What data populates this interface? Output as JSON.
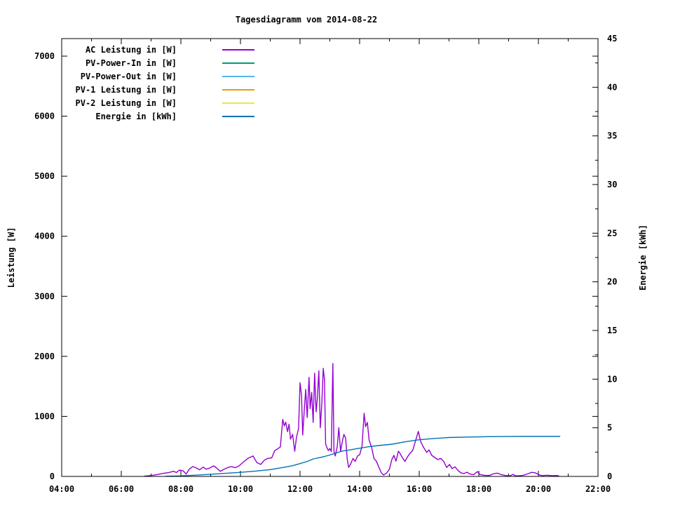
{
  "chart_data": {
    "type": "line",
    "title": "Tagesdiagramm vom 2014-08-22",
    "x_axis": {
      "min": 4,
      "max": 22,
      "major_ticks": [
        {
          "h": 4,
          "label": "04:00"
        },
        {
          "h": 6,
          "label": "06:00"
        },
        {
          "h": 8,
          "label": "08:00"
        },
        {
          "h": 10,
          "label": "10:00"
        },
        {
          "h": 12,
          "label": "12:00"
        },
        {
          "h": 14,
          "label": "14:00"
        },
        {
          "h": 16,
          "label": "16:00"
        },
        {
          "h": 18,
          "label": "18:00"
        },
        {
          "h": 20,
          "label": "20:00"
        },
        {
          "h": 22,
          "label": "22:00"
        }
      ],
      "minor_hours": [
        5,
        7,
        9,
        11,
        13,
        15,
        17,
        19,
        21
      ]
    },
    "y1_axis": {
      "label": "Leistung [W]",
      "min": 0,
      "max": 7000,
      "plot_max": 7292,
      "ticks": [
        {
          "v": 0,
          "label": "0"
        },
        {
          "v": 1000,
          "label": "1000"
        },
        {
          "v": 2000,
          "label": "2000"
        },
        {
          "v": 3000,
          "label": "3000"
        },
        {
          "v": 4000,
          "label": "4000"
        },
        {
          "v": 5000,
          "label": "5000"
        },
        {
          "v": 6000,
          "label": "6000"
        },
        {
          "v": 7000,
          "label": "7000"
        }
      ]
    },
    "y2_axis": {
      "label": "Energie [kWh]",
      "min": 0,
      "max": 45,
      "minor_step": 2.5,
      "ticks": [
        {
          "v": 0,
          "label": "0"
        },
        {
          "v": 5,
          "label": "5"
        },
        {
          "v": 10,
          "label": "10"
        },
        {
          "v": 15,
          "label": "15"
        },
        {
          "v": 20,
          "label": "20"
        },
        {
          "v": 25,
          "label": "25"
        },
        {
          "v": 30,
          "label": "30"
        },
        {
          "v": 35,
          "label": "35"
        },
        {
          "v": 40,
          "label": "40"
        },
        {
          "v": 45,
          "label": "45"
        }
      ]
    },
    "legend": {
      "position": "top-left-inside",
      "items": [
        {
          "label": "AC Leistung in [W]",
          "color": "#9400d3"
        },
        {
          "label": "PV-Power-In in [W]",
          "color": "#009e73"
        },
        {
          "label": "PV-Power-Out in [W]",
          "color": "#56b4e9"
        },
        {
          "label": "PV-1 Leistung in [W]",
          "color": "#e69f00"
        },
        {
          "label": "PV-2 Leistung in [W]",
          "color": "#f0e442"
        },
        {
          "label": "Energie in [kWh]",
          "color": "#0072b2"
        }
      ]
    },
    "series": [
      {
        "name": "AC Leistung in [W]",
        "axis": "y1",
        "color": "#9400d3",
        "points": [
          [
            6.78,
            5
          ],
          [
            7.0,
            15
          ],
          [
            7.2,
            30
          ],
          [
            7.4,
            50
          ],
          [
            7.6,
            65
          ],
          [
            7.75,
            85
          ],
          [
            7.85,
            65
          ],
          [
            7.95,
            105
          ],
          [
            8.07,
            95
          ],
          [
            8.18,
            40
          ],
          [
            8.28,
            120
          ],
          [
            8.4,
            165
          ],
          [
            8.52,
            140
          ],
          [
            8.63,
            110
          ],
          [
            8.75,
            155
          ],
          [
            8.85,
            120
          ],
          [
            8.95,
            135
          ],
          [
            9.1,
            175
          ],
          [
            9.2,
            140
          ],
          [
            9.32,
            85
          ],
          [
            9.45,
            120
          ],
          [
            9.58,
            150
          ],
          [
            9.7,
            165
          ],
          [
            9.82,
            145
          ],
          [
            9.95,
            175
          ],
          [
            10.1,
            240
          ],
          [
            10.25,
            300
          ],
          [
            10.42,
            340
          ],
          [
            10.55,
            230
          ],
          [
            10.68,
            200
          ],
          [
            10.8,
            270
          ],
          [
            10.92,
            300
          ],
          [
            11.05,
            310
          ],
          [
            11.15,
            430
          ],
          [
            11.25,
            460
          ],
          [
            11.34,
            490
          ],
          [
            11.42,
            950
          ],
          [
            11.47,
            840
          ],
          [
            11.52,
            905
          ],
          [
            11.58,
            745
          ],
          [
            11.63,
            870
          ],
          [
            11.68,
            620
          ],
          [
            11.75,
            700
          ],
          [
            11.82,
            420
          ],
          [
            11.88,
            650
          ],
          [
            11.95,
            800
          ],
          [
            12.0,
            1560
          ],
          [
            12.05,
            1350
          ],
          [
            12.09,
            690
          ],
          [
            12.14,
            1100
          ],
          [
            12.19,
            1450
          ],
          [
            12.24,
            980
          ],
          [
            12.3,
            1650
          ],
          [
            12.34,
            1130
          ],
          [
            12.39,
            1400
          ],
          [
            12.44,
            900
          ],
          [
            12.49,
            1720
          ],
          [
            12.54,
            1075
          ],
          [
            12.58,
            1300
          ],
          [
            12.63,
            1760
          ],
          [
            12.68,
            810
          ],
          [
            12.73,
            1200
          ],
          [
            12.78,
            1800
          ],
          [
            12.82,
            1620
          ],
          [
            12.86,
            540
          ],
          [
            12.9,
            480
          ],
          [
            12.95,
            430
          ],
          [
            13.0,
            465
          ],
          [
            13.05,
            415
          ],
          [
            13.1,
            1880
          ],
          [
            13.14,
            420
          ],
          [
            13.18,
            340
          ],
          [
            13.25,
            500
          ],
          [
            13.3,
            810
          ],
          [
            13.36,
            420
          ],
          [
            13.42,
            580
          ],
          [
            13.47,
            700
          ],
          [
            13.53,
            640
          ],
          [
            13.58,
            300
          ],
          [
            13.63,
            150
          ],
          [
            13.7,
            210
          ],
          [
            13.78,
            300
          ],
          [
            13.85,
            250
          ],
          [
            13.93,
            340
          ],
          [
            14.0,
            360
          ],
          [
            14.08,
            500
          ],
          [
            14.15,
            1050
          ],
          [
            14.2,
            830
          ],
          [
            14.26,
            900
          ],
          [
            14.32,
            600
          ],
          [
            14.4,
            490
          ],
          [
            14.48,
            300
          ],
          [
            14.56,
            255
          ],
          [
            14.65,
            150
          ],
          [
            14.73,
            60
          ],
          [
            14.8,
            25
          ],
          [
            14.9,
            55
          ],
          [
            15.0,
            120
          ],
          [
            15.08,
            280
          ],
          [
            15.15,
            350
          ],
          [
            15.22,
            255
          ],
          [
            15.3,
            420
          ],
          [
            15.36,
            380
          ],
          [
            15.45,
            300
          ],
          [
            15.52,
            250
          ],
          [
            15.6,
            320
          ],
          [
            15.68,
            380
          ],
          [
            15.78,
            430
          ],
          [
            15.88,
            600
          ],
          [
            15.97,
            750
          ],
          [
            16.05,
            580
          ],
          [
            16.15,
            480
          ],
          [
            16.25,
            400
          ],
          [
            16.33,
            440
          ],
          [
            16.42,
            350
          ],
          [
            16.52,
            315
          ],
          [
            16.62,
            280
          ],
          [
            16.72,
            300
          ],
          [
            16.82,
            250
          ],
          [
            16.92,
            150
          ],
          [
            17.02,
            200
          ],
          [
            17.1,
            130
          ],
          [
            17.2,
            160
          ],
          [
            17.3,
            100
          ],
          [
            17.4,
            60
          ],
          [
            17.5,
            48
          ],
          [
            17.6,
            70
          ],
          [
            17.7,
            40
          ],
          [
            17.82,
            28
          ],
          [
            17.95,
            80
          ],
          [
            18.05,
            30
          ],
          [
            18.2,
            18
          ],
          [
            18.35,
            15
          ],
          [
            18.5,
            45
          ],
          [
            18.62,
            55
          ],
          [
            18.75,
            30
          ],
          [
            18.9,
            15
          ],
          [
            19.05,
            10
          ],
          [
            19.15,
            35
          ],
          [
            19.22,
            12
          ],
          [
            19.35,
            10
          ],
          [
            19.5,
            20
          ],
          [
            19.65,
            45
          ],
          [
            19.78,
            68
          ],
          [
            19.9,
            60
          ],
          [
            20.0,
            30
          ],
          [
            20.12,
            14
          ],
          [
            20.3,
            20
          ],
          [
            20.45,
            12
          ],
          [
            20.6,
            15
          ],
          [
            20.68,
            10
          ]
        ]
      },
      {
        "name": "PV-Power-In in [W]",
        "axis": "y1",
        "color": "#009e73",
        "points": []
      },
      {
        "name": "PV-Power-Out in [W]",
        "axis": "y1",
        "color": "#56b4e9",
        "points": []
      },
      {
        "name": "PV-1 Leistung in [W]",
        "axis": "y1",
        "color": "#e69f00",
        "points": []
      },
      {
        "name": "PV-2 Leistung in [W]",
        "axis": "y1",
        "color": "#f0e442",
        "points": []
      },
      {
        "name": "Energie in [kWh]",
        "axis": "y2",
        "color": "#0072b2",
        "points": [
          [
            7.5,
            0.02
          ],
          [
            8.0,
            0.06
          ],
          [
            8.5,
            0.13
          ],
          [
            9.0,
            0.22
          ],
          [
            9.5,
            0.32
          ],
          [
            10.0,
            0.42
          ],
          [
            10.5,
            0.55
          ],
          [
            11.0,
            0.7
          ],
          [
            11.5,
            0.96
          ],
          [
            11.75,
            1.1
          ],
          [
            12.0,
            1.32
          ],
          [
            12.25,
            1.55
          ],
          [
            12.45,
            1.8
          ],
          [
            12.75,
            2.0
          ],
          [
            13.0,
            2.2
          ],
          [
            13.2,
            2.4
          ],
          [
            13.41,
            2.6
          ],
          [
            13.7,
            2.75
          ],
          [
            14.0,
            2.9
          ],
          [
            14.3,
            3.05
          ],
          [
            14.63,
            3.17
          ],
          [
            15.1,
            3.32
          ],
          [
            15.5,
            3.55
          ],
          [
            16.0,
            3.77
          ],
          [
            16.5,
            3.9
          ],
          [
            17.0,
            4.0
          ],
          [
            17.9,
            4.06
          ],
          [
            18.3,
            4.09
          ],
          [
            19.0,
            4.1
          ],
          [
            19.5,
            4.11
          ],
          [
            20.0,
            4.11
          ],
          [
            20.72,
            4.11
          ]
        ]
      }
    ]
  }
}
